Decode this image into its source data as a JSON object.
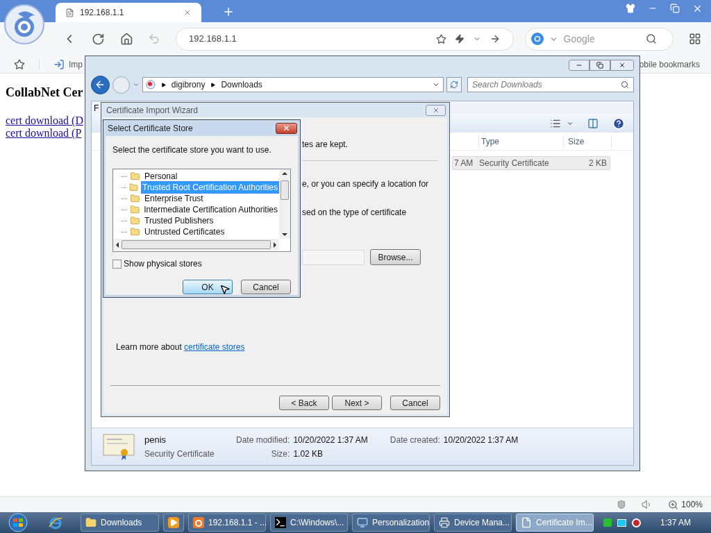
{
  "browser": {
    "tabs": [
      {
        "title": "192.168.1.1",
        "selected": true
      }
    ],
    "address": "192.168.1.1",
    "search": {
      "placeholder": "Google"
    },
    "bookmarks": [
      {
        "label": "Imp"
      }
    ],
    "bookmarks_right": "obile bookmarks"
  },
  "page": {
    "heading": "CollabNet Cer",
    "links": [
      "cert download (D",
      "cert download (P"
    ]
  },
  "explorer": {
    "breadcrumb": [
      "digibrony",
      "Downloads"
    ],
    "search_placeholder": "Search Downloads",
    "menu": [
      "F"
    ],
    "columns": [
      "",
      "Type",
      "Size"
    ],
    "rows": [
      {
        "cells": [
          "7 AM",
          "Security Certificate",
          "2 KB"
        ],
        "selected": true
      }
    ],
    "details": {
      "name": "penis",
      "type": "Security Certificate",
      "fields": [
        {
          "label": "Date modified:",
          "value": "10/20/2022 1:37 AM"
        },
        {
          "label": "Size:",
          "value": "1.02 KB"
        },
        {
          "label": "Date created:",
          "value": "10/20/2022 1:37 AM"
        }
      ]
    }
  },
  "wizard": {
    "title": "Certificate Import Wizard",
    "texts": [
      "tes are kept.",
      "e, or you can specify a location for",
      "sed on the type of certificate"
    ],
    "browse": "Browse...",
    "learn": {
      "text": "Learn more about",
      "link": "certificate stores"
    },
    "buttons": [
      "< Back",
      "Next >",
      "Cancel"
    ]
  },
  "store": {
    "title": "Select Certificate Store",
    "prompt": "Select the certificate store you want to use.",
    "items": [
      {
        "label": "Personal",
        "selected": false
      },
      {
        "label": "Trusted Root Certification Authorities",
        "selected": true
      },
      {
        "label": "Enterprise Trust",
        "selected": false
      },
      {
        "label": "Intermediate Certification Authorities",
        "selected": false
      },
      {
        "label": "Trusted Publishers",
        "selected": false
      },
      {
        "label": "Untrusted Certificates",
        "selected": false
      }
    ],
    "show_physical": {
      "label": "Show physical stores",
      "checked": false
    },
    "buttons": [
      {
        "label": "OK",
        "focused": true
      },
      {
        "label": "Cancel",
        "focused": false
      }
    ]
  },
  "status": {
    "zoom": "100%"
  },
  "taskbar": {
    "items": [
      {
        "kind": "folder",
        "label": "Downloads",
        "selected": false
      },
      {
        "kind": "media",
        "selected": false
      },
      {
        "kind": "browser",
        "label": "192.168.1.1 - ...",
        "selected": false
      },
      {
        "kind": "console",
        "label": "C:\\Windows\\...",
        "selected": false
      },
      {
        "kind": "display",
        "label": "Personalization",
        "selected": false
      },
      {
        "kind": "device",
        "label": "Device Mana...",
        "selected": false
      },
      {
        "kind": "document",
        "label": "Certificate Im...",
        "selected": true
      }
    ],
    "clock": "1:37 AM"
  }
}
